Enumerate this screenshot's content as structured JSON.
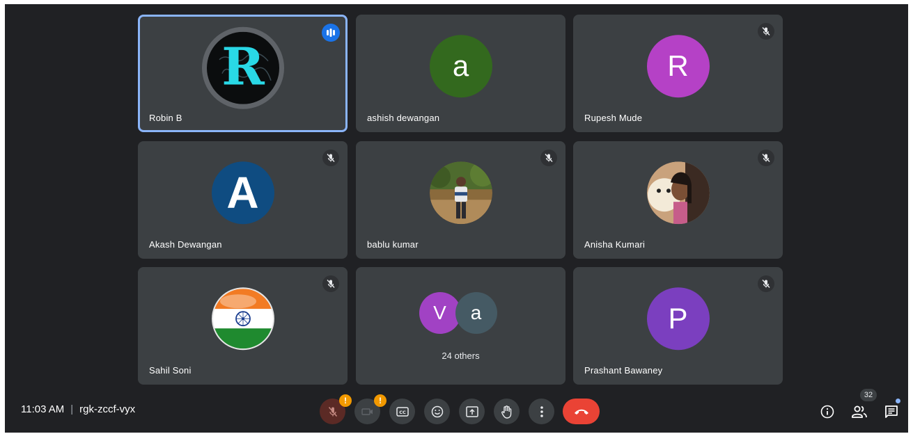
{
  "participants": [
    {
      "name": "Robin B",
      "initial": "R",
      "avatar_type": "image-logo",
      "speaking": true,
      "muted": false
    },
    {
      "name": "ashish dewangan",
      "initial": "a",
      "avatar_color": "#33691e",
      "muted": false
    },
    {
      "name": "Rupesh Mude",
      "initial": "R",
      "avatar_color": "#b541c6",
      "muted": true
    },
    {
      "name": "Akash Dewangan",
      "initial": "A",
      "avatar_color": "#0f4c81",
      "muted": true
    },
    {
      "name": "bablu kumar",
      "initial": "",
      "avatar_type": "photo",
      "muted": true
    },
    {
      "name": "Anisha Kumari",
      "initial": "",
      "avatar_type": "photo",
      "muted": true
    },
    {
      "name": "Sahil Soni",
      "initial": "",
      "avatar_type": "flag-india",
      "muted": true
    },
    {
      "name": "Prashant Bawaney",
      "initial": "P",
      "avatar_color": "#7b3fbf",
      "muted": true
    }
  ],
  "others": {
    "label": "24 others",
    "avatars": [
      {
        "initial": "V",
        "color": "#a142c4"
      },
      {
        "initial": "a",
        "color": "#455a64"
      }
    ]
  },
  "meeting": {
    "time": "11:03 AM",
    "code": "rgk-zccf-vyx"
  },
  "controls": {
    "mic": {
      "icon": "mic-off-icon",
      "warning": "!"
    },
    "camera": {
      "icon": "camera-off-icon",
      "warning": "!"
    },
    "captions": {
      "icon": "closed-captions-icon"
    },
    "reactions": {
      "icon": "emoji-icon"
    },
    "present": {
      "icon": "present-screen-icon"
    },
    "raise_hand": {
      "icon": "raise-hand-icon"
    },
    "more": {
      "icon": "more-options-icon"
    },
    "leave": {
      "icon": "end-call-icon"
    }
  },
  "side": {
    "info": {
      "icon": "info-icon"
    },
    "people": {
      "icon": "people-icon",
      "count": "32"
    },
    "chat": {
      "icon": "chat-icon"
    }
  },
  "colors": {
    "background": "#202124",
    "tile": "#3c4043",
    "active_border": "#8ab4f8",
    "leave_red": "#ea4335",
    "warning": "#f29900"
  }
}
